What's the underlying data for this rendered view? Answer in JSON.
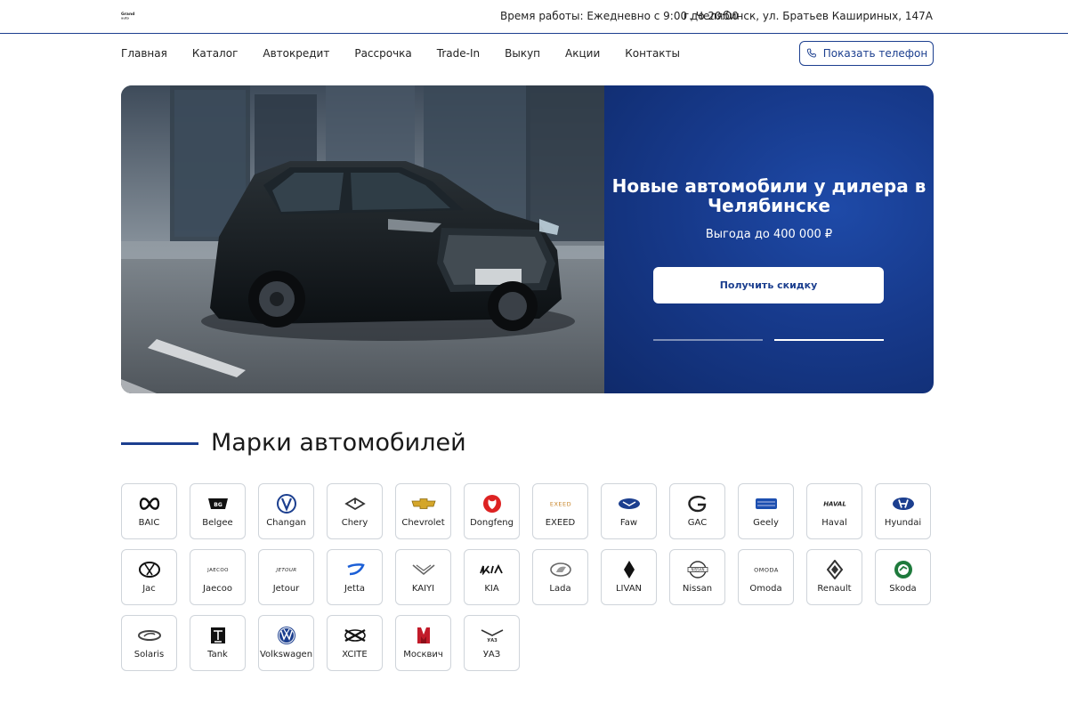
{
  "header": {
    "logo_text": "Grand auto",
    "hours": "Время работы: Ежедневно с 9:00 до 20:00",
    "address": "г. Челябинск, ул. Братьев Кашириных, 147А"
  },
  "nav": {
    "items": [
      "Главная",
      "Каталог",
      "Автокредит",
      "Рассрочка",
      "Trade-In",
      "Выкуп",
      "Акции",
      "Контакты"
    ],
    "phone_button": "Показать телефон"
  },
  "hero": {
    "title": "Новые автомобили у дилера в Челябинске",
    "subtitle": "Выгода до 400 000 ₽",
    "button": "Получить скидку",
    "slides": 2,
    "active_slide": 2
  },
  "brands_section": {
    "title": "Марки автомобилей",
    "items": [
      {
        "name": "BAIC",
        "icon": "baic-logo-icon"
      },
      {
        "name": "Belgee",
        "icon": "belgee-logo-icon"
      },
      {
        "name": "Changan",
        "icon": "changan-logo-icon"
      },
      {
        "name": "Chery",
        "icon": "chery-logo-icon"
      },
      {
        "name": "Chevrolet",
        "icon": "chevrolet-logo-icon"
      },
      {
        "name": "Dongfeng",
        "icon": "dongfeng-logo-icon"
      },
      {
        "name": "EXEED",
        "icon": "exeed-logo-icon"
      },
      {
        "name": "Faw",
        "icon": "faw-logo-icon"
      },
      {
        "name": "GAC",
        "icon": "gac-logo-icon"
      },
      {
        "name": "Geely",
        "icon": "geely-logo-icon"
      },
      {
        "name": "Haval",
        "icon": "haval-logo-icon"
      },
      {
        "name": "Hyundai",
        "icon": "hyundai-logo-icon"
      },
      {
        "name": "Jac",
        "icon": "jac-logo-icon"
      },
      {
        "name": "Jaecoo",
        "icon": "jaecoo-logo-icon"
      },
      {
        "name": "Jetour",
        "icon": "jetour-logo-icon"
      },
      {
        "name": "Jetta",
        "icon": "jetta-logo-icon"
      },
      {
        "name": "KAIYI",
        "icon": "kaiyi-logo-icon"
      },
      {
        "name": "KIA",
        "icon": "kia-logo-icon"
      },
      {
        "name": "Lada",
        "icon": "lada-logo-icon"
      },
      {
        "name": "LIVAN",
        "icon": "livan-logo-icon"
      },
      {
        "name": "Nissan",
        "icon": "nissan-logo-icon"
      },
      {
        "name": "Omoda",
        "icon": "omoda-logo-icon"
      },
      {
        "name": "Renault",
        "icon": "renault-logo-icon"
      },
      {
        "name": "Skoda",
        "icon": "skoda-logo-icon"
      },
      {
        "name": "Solaris",
        "icon": "solaris-logo-icon"
      },
      {
        "name": "Tank",
        "icon": "tank-logo-icon"
      },
      {
        "name": "Volkswagen",
        "icon": "volkswagen-logo-icon"
      },
      {
        "name": "XCITE",
        "icon": "xcite-logo-icon"
      },
      {
        "name": "Москвич",
        "icon": "moskvich-logo-icon"
      },
      {
        "name": "УАЗ",
        "icon": "uaz-logo-icon"
      }
    ]
  },
  "colors": {
    "accent": "#1c3f8f",
    "hero_panel": "#173a8c",
    "card_border": "#cfd4da"
  }
}
